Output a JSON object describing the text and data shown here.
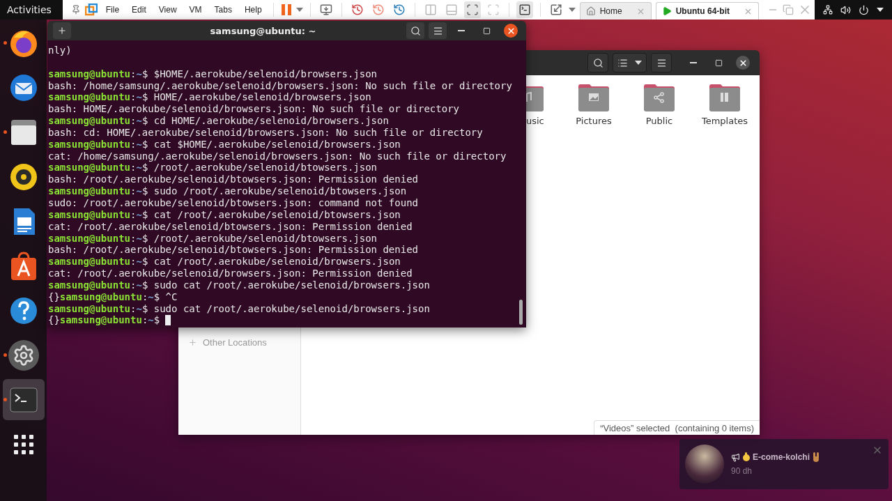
{
  "top_bar": {
    "activities": "Activities"
  },
  "vmware": {
    "menu": [
      "File",
      "Edit",
      "View",
      "VM",
      "Tabs",
      "Help"
    ],
    "tabs": [
      {
        "label": "Home",
        "selected": false
      },
      {
        "label": "Ubuntu 64-bit",
        "selected": true
      }
    ]
  },
  "dock": {
    "items": [
      {
        "kind": "browser",
        "running": true,
        "selected": false
      },
      {
        "kind": "mail",
        "running": false,
        "selected": false
      },
      {
        "kind": "files",
        "running": true,
        "selected": false
      },
      {
        "kind": "music",
        "running": false,
        "selected": false
      },
      {
        "kind": "document",
        "running": false,
        "selected": false
      },
      {
        "kind": "store",
        "running": false,
        "selected": false
      },
      {
        "kind": "help",
        "running": false,
        "selected": false
      },
      {
        "kind": "settings",
        "running": true,
        "selected": false
      },
      {
        "kind": "terminal",
        "running": true,
        "selected": true
      },
      {
        "kind": "apps",
        "running": false,
        "selected": false
      }
    ]
  },
  "terminal": {
    "title": "samsung@ubuntu: ~",
    "lines": [
      {
        "kind": "output",
        "text": "nly)"
      },
      {
        "kind": "blank"
      },
      {
        "kind": "prompt",
        "user": "samsung@ubuntu",
        "sep": ":",
        "dir": "~",
        "command": "$ $HOME/.aerokube/selenoid/browsers.json"
      },
      {
        "kind": "output",
        "text": "bash: /home/samsung/.aerokube/selenoid/browsers.json: No such file or directory"
      },
      {
        "kind": "prompt",
        "user": "samsung@ubuntu",
        "sep": ":",
        "dir": "~",
        "command": "$ HOME/.aerokube/selenoid/browsers.json"
      },
      {
        "kind": "output",
        "text": "bash: HOME/.aerokube/selenoid/browsers.json: No such file or directory"
      },
      {
        "kind": "prompt",
        "user": "samsung@ubuntu",
        "sep": ":",
        "dir": "~",
        "command": "$ cd HOME/.aerokube/selenoid/browsers.json"
      },
      {
        "kind": "output",
        "text": "bash: cd: HOME/.aerokube/selenoid/browsers.json: No such file or directory"
      },
      {
        "kind": "prompt",
        "user": "samsung@ubuntu",
        "sep": ":",
        "dir": "~",
        "command": "$ cat $HOME/.aerokube/selenoid/browsers.json"
      },
      {
        "kind": "output",
        "text": "cat: /home/samsung/.aerokube/selenoid/browsers.json: No such file or directory"
      },
      {
        "kind": "prompt",
        "user": "samsung@ubuntu",
        "sep": ":",
        "dir": "~",
        "command": "$ /root/.aerokube/selenoid/btowsers.json"
      },
      {
        "kind": "output",
        "text": "bash: /root/.aerokube/selenoid/btowsers.json: Permission denied"
      },
      {
        "kind": "prompt",
        "user": "samsung@ubuntu",
        "sep": ":",
        "dir": "~",
        "command": "$ sudo /root/.aerokube/selenoid/btowsers.json"
      },
      {
        "kind": "output",
        "text": "sudo: /root/.aerokube/selenoid/btowsers.json: command not found"
      },
      {
        "kind": "prompt",
        "user": "samsung@ubuntu",
        "sep": ":",
        "dir": "~",
        "command": "$ cat /root/.aerokube/selenoid/btowsers.json"
      },
      {
        "kind": "output",
        "text": "cat: /root/.aerokube/selenoid/btowsers.json: Permission denied"
      },
      {
        "kind": "prompt",
        "user": "samsung@ubuntu",
        "sep": ":",
        "dir": "~",
        "command": "$ /root/.aerokube/selenoid/btowsers.json"
      },
      {
        "kind": "output",
        "text": "bash: /root/.aerokube/selenoid/btowsers.json: Permission denied"
      },
      {
        "kind": "prompt",
        "user": "samsung@ubuntu",
        "sep": ":",
        "dir": "~",
        "command": "$ cat /root/.aerokube/selenoid/browsers.json"
      },
      {
        "kind": "output",
        "text": "cat: /root/.aerokube/selenoid/browsers.json: Permission denied"
      },
      {
        "kind": "prompt",
        "user": "samsung@ubuntu",
        "sep": ":",
        "dir": "~",
        "command": "$ sudo cat /root/.aerokube/selenoid/browsers.json"
      },
      {
        "kind": "prompt",
        "before": "{}",
        "user": "samsung@ubuntu",
        "sep": ":",
        "dir": "~",
        "command": "$ ^C"
      },
      {
        "kind": "prompt",
        "user": "samsung@ubuntu",
        "sep": ":",
        "dir": "~",
        "command": "$ sudo cat /root/.aerokube/selenoid/browsers.json"
      },
      {
        "kind": "prompt",
        "before": "{}",
        "user": "samsung@ubuntu",
        "sep": ":",
        "dir": "~",
        "command": "$",
        "cursor": true
      }
    ]
  },
  "files": {
    "folders": [
      {
        "label": "usic",
        "kind": "clipped"
      },
      {
        "label": "Pictures",
        "kind": "folder"
      },
      {
        "label": "Public",
        "kind": "folder"
      },
      {
        "label": "Templates",
        "kind": "folder"
      }
    ],
    "sidebar": [
      {
        "label": "Other Locations"
      }
    ],
    "status": "“Videos” selected  (containing 0 items)"
  },
  "notification": {
    "title": "E-come-kolchi",
    "price": "90 dh"
  }
}
